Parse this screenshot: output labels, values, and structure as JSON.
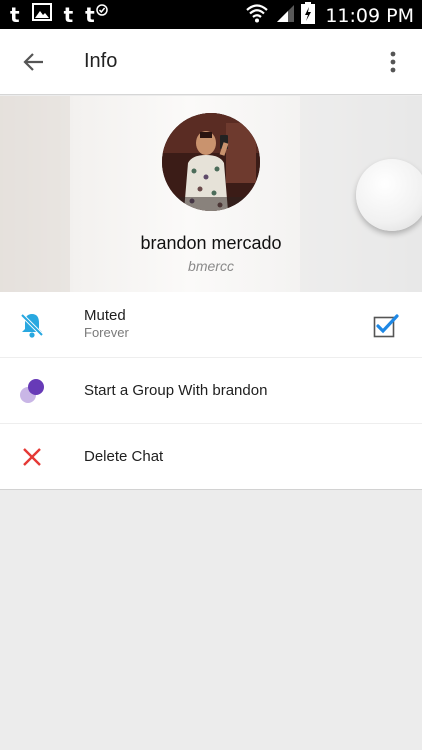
{
  "statusbar": {
    "time": "11:09 PM",
    "left_icons": [
      "tumblr-icon",
      "image-icon",
      "tumblr-icon",
      "tumblr-check-icon"
    ],
    "tumblr_glyph": "t"
  },
  "appbar": {
    "title": "Info"
  },
  "profile": {
    "display_name": "brandon mercado",
    "username": "bmercc"
  },
  "list": {
    "muted": {
      "label": "Muted",
      "sublabel": "Forever",
      "checked": true
    },
    "group": {
      "label": "Start a Group With brandon"
    },
    "delete": {
      "label": "Delete Chat"
    }
  },
  "colors": {
    "accent": "#2196f3",
    "mute_icon": "#29a8e0",
    "group_dark": "#673ab7",
    "group_light": "#c9b6e6",
    "delete": "#e53935"
  }
}
